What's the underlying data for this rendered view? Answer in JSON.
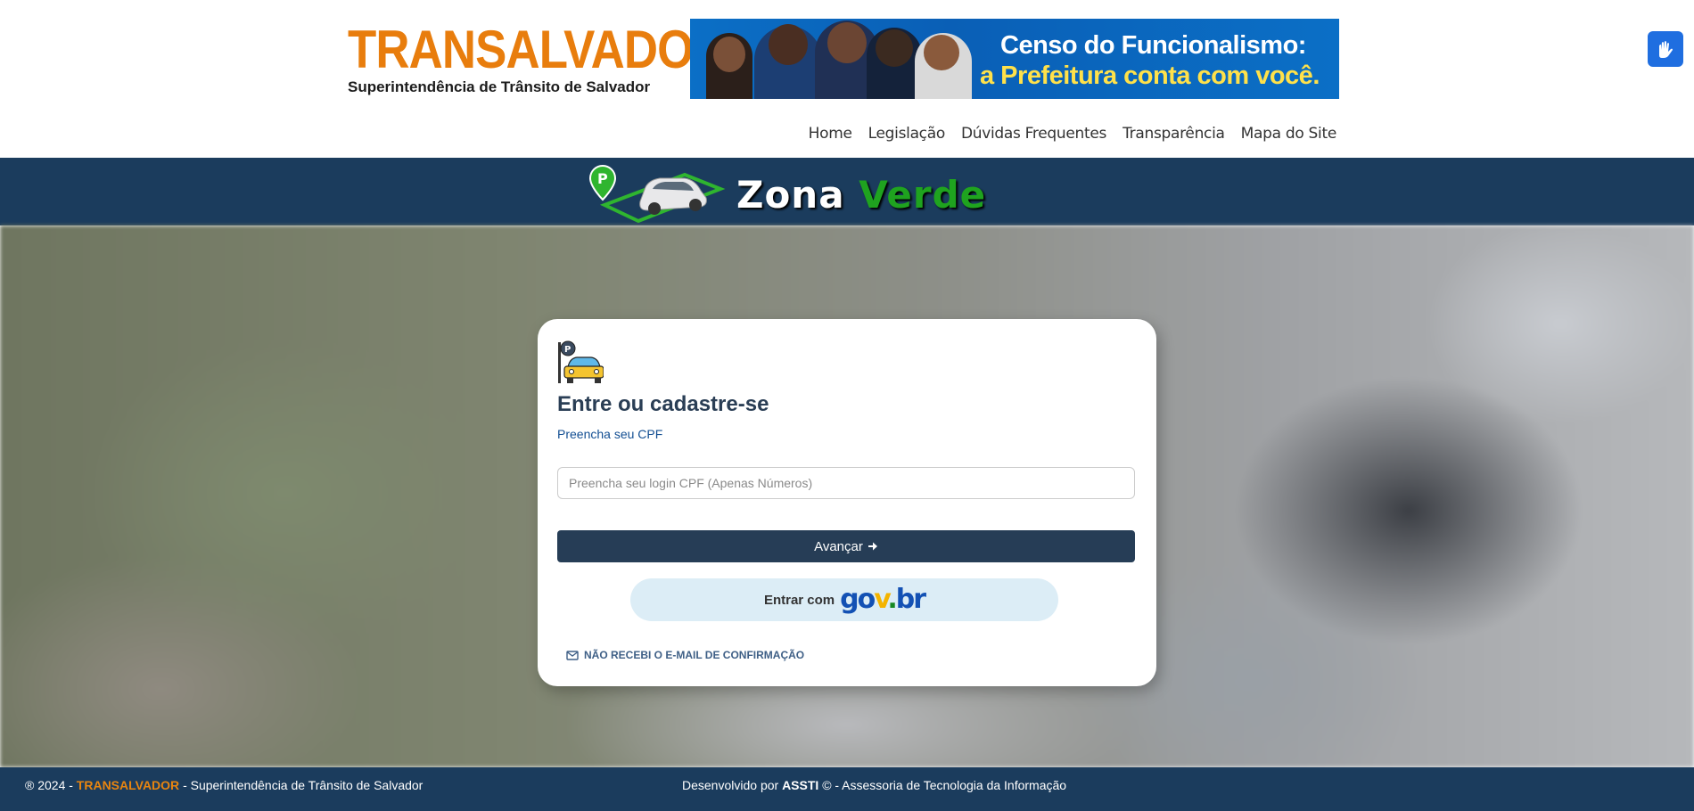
{
  "header": {
    "logo_title": "TRANSALVADOR",
    "logo_subtitle": "Superintendência de Trânsito de Salvador",
    "banner_title": "Censo do Funcionalismo:",
    "banner_subtitle": "a Prefeitura conta com você.",
    "nav": [
      "Home",
      "Legislação",
      "Dúvidas Frequentes",
      "Transparência",
      "Mapa do Site"
    ]
  },
  "band": {
    "zona": "Zona",
    "verde": "Verde"
  },
  "login": {
    "title": "Entre ou cadastre-se",
    "subtitle": "Preencha seu CPF",
    "cpf_placeholder": "Preencha seu login CPF (Apenas Números)",
    "cpf_value": "",
    "submit_label": "Avançar",
    "gov_label": "Entrar com",
    "gov_brand": [
      "go",
      "v",
      ".",
      "br"
    ],
    "email_link": "NÃO RECEBI O E-MAIL DE CONFIRMAÇÃO"
  },
  "footer": {
    "copyright": "® 2024 -",
    "brand": "TRANSALVADOR",
    "org": "- Superintendência de Trânsito de Salvador",
    "dev_prefix": "Desenvolvido por",
    "dev_name": "ASSTI",
    "dev_suffix": "© - Assessoria de Tecnologia da Informação"
  },
  "colors": {
    "brand_orange": "#e87d0d",
    "navy": "#1b3c5d",
    "button": "#263d56",
    "green": "#1fa31f",
    "gov_bg": "#dcedf6"
  },
  "icons": [
    "vlibras-hands-icon",
    "parking-car-icon",
    "arrow-right-icon",
    "envelope-icon",
    "zona-verde-logo"
  ]
}
